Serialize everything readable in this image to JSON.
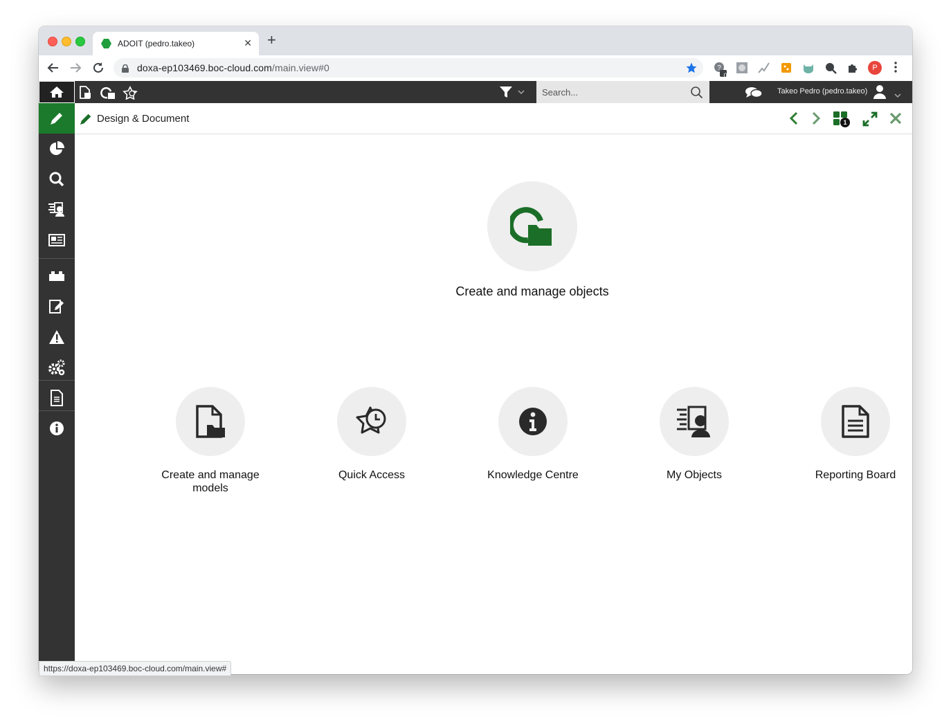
{
  "browser": {
    "tab_title": "ADOIT (pedro.takeo)",
    "url_host": "doxa-ep103469.boc-cloud.com",
    "url_path": "/main.view#0",
    "profile_initial": "P",
    "extension_badge": "0",
    "status_url": "https://doxa-ep103469.boc-cloud.com/main.view#"
  },
  "appbar": {
    "search_placeholder": "Search...",
    "user_label": "Takeo Pedro (pedro.takeo)"
  },
  "breadcrumb": {
    "title": "Design & Document",
    "widget_badge": "1"
  },
  "tiles": {
    "featured": {
      "label": "Create and manage objects",
      "icon": "object-folder-icon"
    },
    "items": [
      {
        "label": "Create and manage models",
        "icon": "model-document-icon"
      },
      {
        "label": "Quick Access",
        "icon": "star-clock-icon"
      },
      {
        "label": "Knowledge Centre",
        "icon": "info-icon"
      },
      {
        "label": "My Objects",
        "icon": "user-list-icon"
      },
      {
        "label": "Reporting Board",
        "icon": "report-document-icon"
      }
    ]
  },
  "colors": {
    "accent_green": "#1b7a2b",
    "dark_bar": "#333333"
  }
}
